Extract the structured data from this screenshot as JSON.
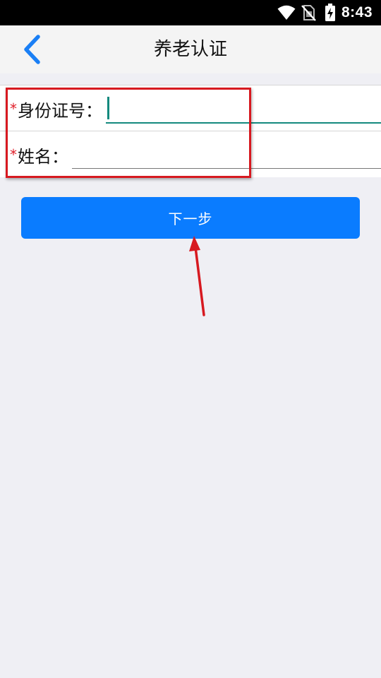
{
  "status_bar": {
    "time": "8:43",
    "icons": [
      "wifi-icon",
      "no-sim-icon",
      "battery-charging-icon"
    ]
  },
  "header": {
    "title": "养老认证",
    "back_icon": "chevron-left-icon"
  },
  "form": {
    "id_field": {
      "required_mark": "*",
      "label": "身份证号：",
      "value": "",
      "placeholder": ""
    },
    "name_field": {
      "required_mark": "*",
      "label": "姓名：",
      "value": "",
      "placeholder": ""
    }
  },
  "actions": {
    "next_label": "下一步"
  },
  "colors": {
    "accent_blue": "#0a7cff",
    "input_focus": "#148a7e",
    "required_red": "#e0202a",
    "annotation_red": "#d71920"
  }
}
